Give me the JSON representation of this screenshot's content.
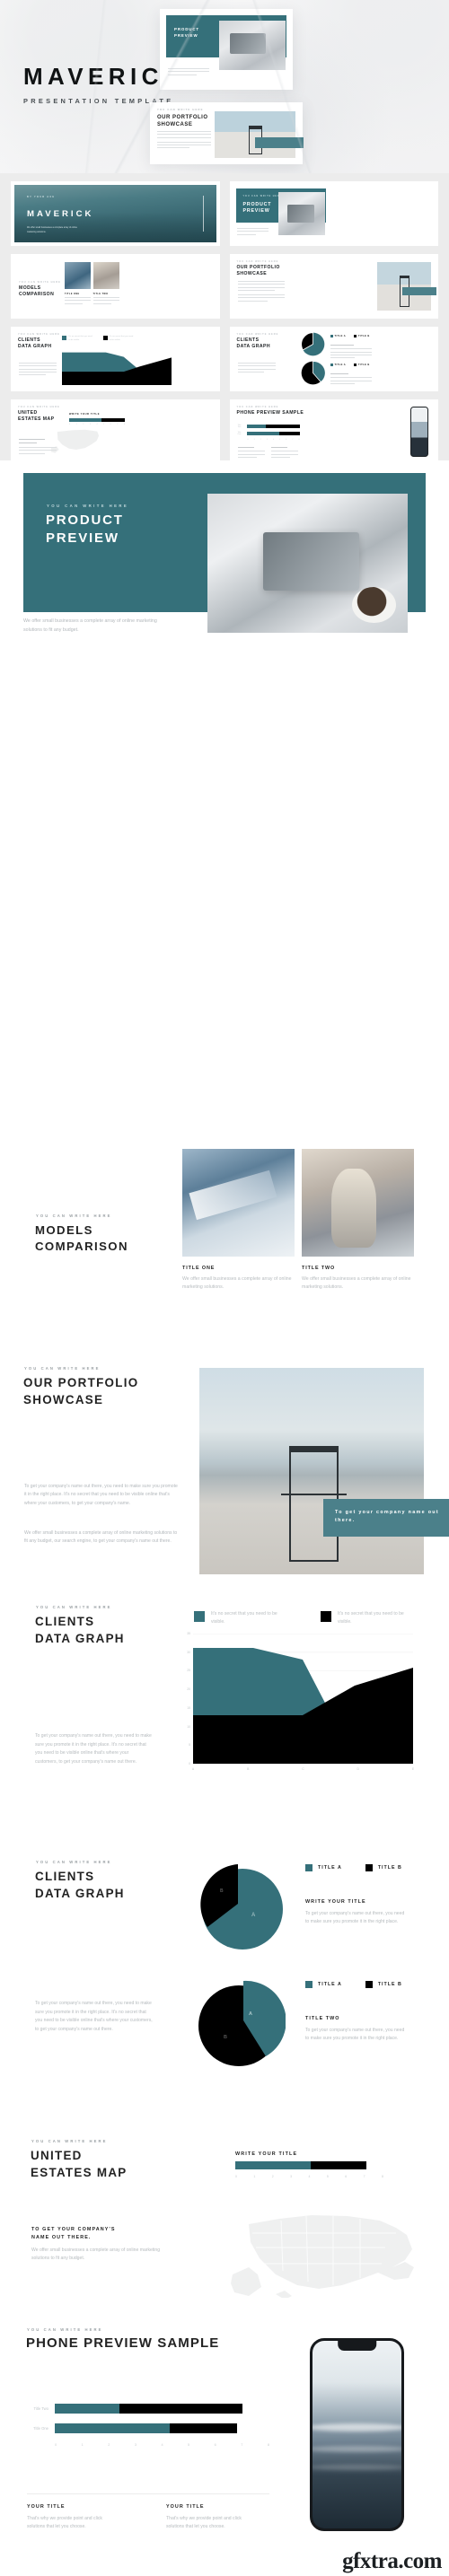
{
  "brand": {
    "name": "MAVERICK",
    "subtitle": "PRESENTATION TEMPLATE"
  },
  "colors": {
    "teal": "#35707a",
    "teal_light": "#4b808a",
    "black": "#000000",
    "muted": "#b3b8bc",
    "grid_bg": "#ececec"
  },
  "hero_cards": {
    "card1": {
      "title": "PRODUCT\nPREVIEW"
    },
    "card2": {
      "eyebrow": "YOU CAN WRITE HERE",
      "title": "OUR PORTFOLIO\nSHOWCASE",
      "badge": "To get your company name out there."
    },
    "card3": {
      "eyebrow": "YOU CAN WRITE HERE",
      "title": "MODELS\nCOMPARISON"
    }
  },
  "thumbnails": [
    {
      "eyebrow": "BY YOUR AXE",
      "title": "MAVERICK",
      "body": "We offer small businesses a complete array of online marketing solutions."
    },
    {
      "eyebrow": "YOU CAN WRITE HERE",
      "title": "PRODUCT PREVIEW",
      "body": "We offer small businesses a complete array of online marketing solutions to fit any budget."
    },
    {
      "eyebrow": "YOU CAN WRITE HERE",
      "title": "MODELS COMPARISON",
      "cap1": "TITLE ONE",
      "cap2": "TITLE TWO",
      "capbody": "We offer small businesses a complete array of online marketing solutions."
    },
    {
      "eyebrow": "YOU CAN WRITE HERE",
      "title": "OUR PORTFOLIO SHOWCASE",
      "badge": "To get your company name out there."
    },
    {
      "eyebrow": "YOU CAN WRITE HERE",
      "title": "CLIENTS DATA GRAPH",
      "legend1": "It's no secret that you need to be visible.",
      "legend2": "It's no secret that you need to be visible."
    },
    {
      "eyebrow": "YOU CAN WRITE HERE",
      "title": "CLIENTS DATA GRAPH",
      "legend1": "TITLE A",
      "legend2": "TITLE B"
    },
    {
      "eyebrow": "YOU CAN WRITE HERE",
      "title": "UNITED ESTATES MAP",
      "bar_title": "WRITE YOUR TITLE"
    },
    {
      "eyebrow": "YOU CAN WRITE HERE",
      "title": "PHONE PREVIEW SAMPLE",
      "bar1": "Title One",
      "bar2": "Title Two"
    }
  ],
  "product_preview": {
    "eyebrow": "YOU CAN WRITE HERE",
    "title": "PRODUCT PREVIEW",
    "body": "We offer small businesses a complete array of online marketing solutions to fit any budget."
  },
  "models_comparison": {
    "eyebrow": "YOU CAN WRITE HERE",
    "title": "MODELS COMPARISON",
    "cards": [
      {
        "title": "TITLE ONE",
        "body": "We offer small businesses a complete array of online marketing solutions."
      },
      {
        "title": "TITLE TWO",
        "body": "We offer small businesses a complete array of online marketing solutions."
      }
    ]
  },
  "portfolio_showcase": {
    "eyebrow": "YOU CAN WRITE HERE",
    "title": "OUR PORTFOLIO SHOWCASE",
    "paragraph1": "To get your company's name out there, you need to make sure you promote it in the right place. It's no secret that you need to be visible online that's where your customers, to get your company's name.",
    "paragraph2": "We offer small businesses a complete array of online marketing solutions to fit any budget, our search engine, to get your company's name out there.",
    "badge": "To get your company name out there."
  },
  "area_slide": {
    "eyebrow": "YOU CAN WRITE HERE",
    "title": "CLIENTS DATA GRAPH",
    "legend": [
      {
        "label": "It's no secret that you need to be visible.",
        "color": "#35707a"
      },
      {
        "label": "It's no secret that you need to be visible.",
        "color": "#000000"
      }
    ],
    "body": "To get your company's name out there, you need to make sure you promote it in the right place. It's no secret that you need to be visible online that's where your customers, to get your company's name out there."
  },
  "pie_slide": {
    "eyebrow": "YOU CAN WRITE HERE",
    "title": "CLIENTS DATA GRAPH",
    "body": "To get your company's name out there, you need to make sure you promote it in the right place. It's no secret that you need to be visible online that's where your customers, to get your company's name out there.",
    "blocks": [
      {
        "legend_a": "TITLE A",
        "legend_b": "TITLE B",
        "title": "WRITE YOUR TITLE",
        "body": "To get your company's name out there, you need to make sure you promote it in the right place."
      },
      {
        "legend_a": "TITLE A",
        "legend_b": "TITLE B",
        "title": "TITLE TWO",
        "body": "To get your company's name out there, you need to make sure you promote it in the right place."
      }
    ]
  },
  "map_slide": {
    "eyebrow": "YOU CAN WRITE HERE",
    "title": "UNITED ESTATES MAP",
    "bar_title": "WRITE YOUR TITLE",
    "subtitle": "TO GET YOUR COMPANY'S NAME OUT THERE.",
    "body": "We offer small businesses a complete array of online marketing solutions to fit any budget.",
    "ticks": [
      "0",
      "1",
      "2",
      "3",
      "4",
      "5",
      "6",
      "7",
      "8"
    ]
  },
  "phone_slide": {
    "eyebrow": "YOU CAN WRITE HERE",
    "title": "PHONE PREVIEW SAMPLE",
    "cards": [
      {
        "title": "YOUR TITLE",
        "body": "That's why we provide point and click solutions that let you choose."
      },
      {
        "title": "YOUR TITLE",
        "body": "That's why we provide point and click solutions that let you choose."
      }
    ]
  },
  "watermark": "gfxtra.com",
  "chart_data": [
    {
      "type": "area",
      "title": "CLIENTS DATA GRAPH",
      "x": [
        "A",
        "B",
        "C",
        "D",
        "E"
      ],
      "series": [
        {
          "name": "It's no secret that you need to be visible.",
          "color": "#35707a",
          "values": [
            31,
            31,
            28,
            15,
            0
          ]
        },
        {
          "name": "It's no secret that you need to be visible.",
          "color": "#000000",
          "values": [
            13,
            13,
            13,
            21,
            29
          ]
        }
      ],
      "ylim": [
        0,
        35
      ],
      "yticks": [
        0,
        5,
        10,
        15,
        20,
        25,
        30,
        35
      ],
      "xticks": [
        "A",
        "B",
        "C",
        "D",
        "E"
      ],
      "grid": true,
      "legend": "top"
    },
    {
      "type": "pie",
      "title": "WRITE YOUR TITLE",
      "labels": [
        "A",
        "B"
      ],
      "values": [
        72,
        28
      ],
      "colors": [
        "#35707a",
        "#000000"
      ],
      "legend": [
        "TITLE A",
        "TITLE B"
      ]
    },
    {
      "type": "pie",
      "title": "TITLE TWO",
      "labels": [
        "A",
        "B"
      ],
      "values": [
        30,
        70
      ],
      "colors": [
        "#35707a",
        "#000000"
      ],
      "legend": [
        "TITLE A",
        "TITLE B"
      ]
    },
    {
      "type": "bar",
      "title": "WRITE YOUR TITLE",
      "orientation": "horizontal",
      "categories": [
        "Series"
      ],
      "series": [
        {
          "name": "teal",
          "color": "#35707a",
          "values": [
            4.1
          ]
        },
        {
          "name": "black",
          "color": "#000000",
          "values": [
            3.0
          ]
        }
      ],
      "xlim": [
        0,
        8
      ],
      "xticks": [
        "0",
        "1",
        "2",
        "3",
        "4",
        "5",
        "6",
        "7",
        "8"
      ]
    },
    {
      "type": "bar",
      "title": "PHONE PREVIEW SAMPLE",
      "orientation": "horizontal",
      "categories": [
        "Title Two",
        "Title One"
      ],
      "series": [
        {
          "name": "teal",
          "color": "#35707a",
          "values": [
            2.4,
            4.3
          ]
        },
        {
          "name": "black",
          "color": "#000000",
          "values": [
            4.6,
            2.5
          ]
        }
      ],
      "xlim": [
        0,
        8
      ],
      "xticks": [
        "0",
        "1",
        "2",
        "3",
        "4",
        "5",
        "6",
        "7",
        "8"
      ]
    }
  ]
}
